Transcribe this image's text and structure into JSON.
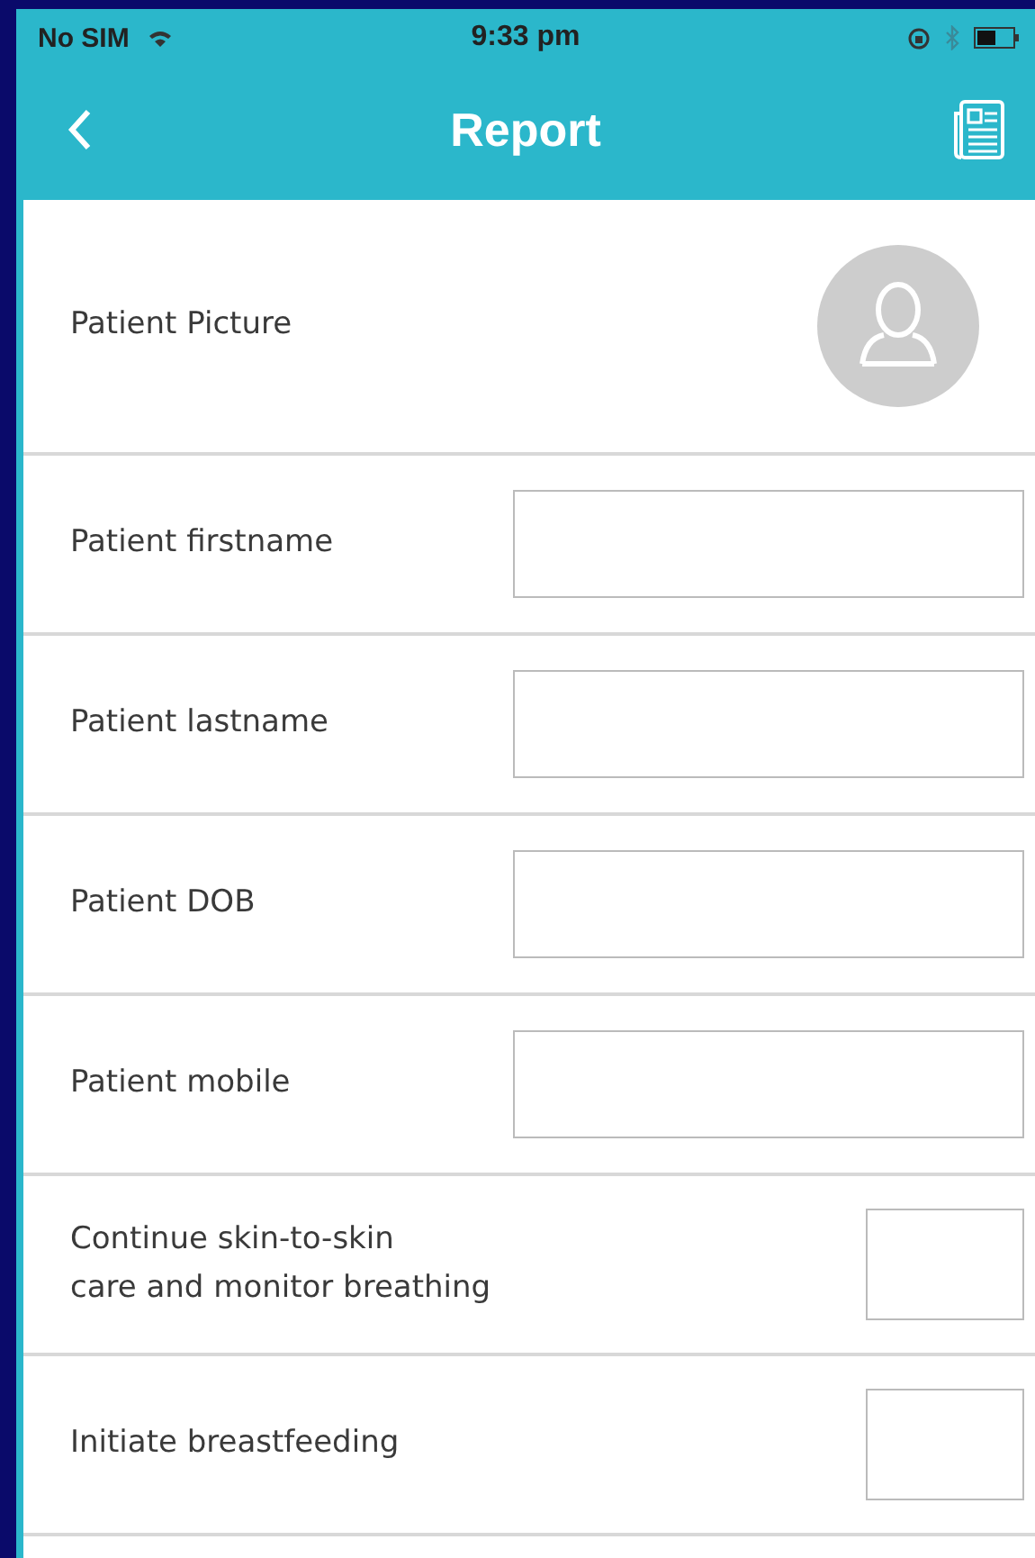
{
  "status_bar": {
    "carrier": "No SIM",
    "time": "9:33 pm"
  },
  "nav": {
    "title": "Report"
  },
  "rows": [
    {
      "kind": "avatar",
      "label": "Patient Picture"
    },
    {
      "kind": "text",
      "label": "Patient firstname"
    },
    {
      "kind": "text",
      "label": "Patient lastname"
    },
    {
      "kind": "text",
      "label": "Patient DOB"
    },
    {
      "kind": "text",
      "label": "Patient mobile"
    },
    {
      "kind": "checkbox",
      "label": "Continue skin-to-skin\ncare and monitor breathing",
      "checked": false
    },
    {
      "kind": "checkbox",
      "label": "Initiate breastfeeding",
      "checked": false
    }
  ]
}
